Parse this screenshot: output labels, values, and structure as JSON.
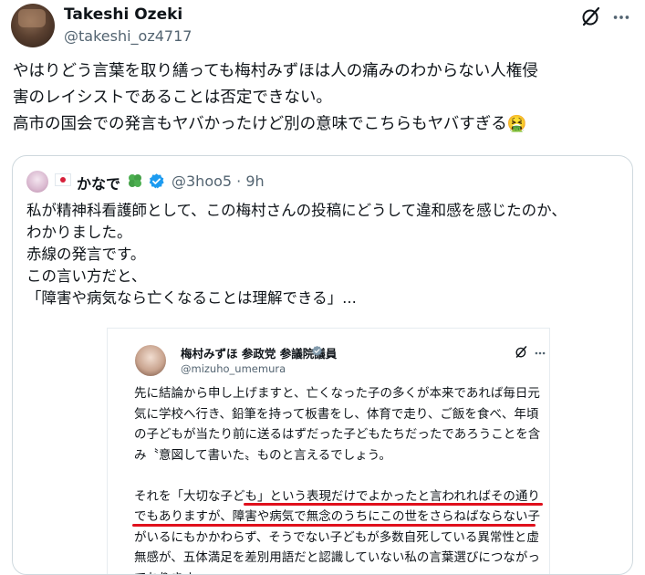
{
  "post": {
    "author_name": "Takeshi Ozeki",
    "author_handle": "@takeshi_oz4717",
    "text": "やはりどう言葉を取り繕っても梅村みずほは人の痛みのわからない人権侵\n害のレイシストであることは否定できない。\n高市の国会での発言もヤバかったけど別の意味でこちらもヤバすぎる🤮"
  },
  "quote": {
    "name": "かなで",
    "handle": "@3hoo5",
    "time": "9h",
    "meta": "@3hoo5 · 9h",
    "text": "私が精神科看護師として、この梅村さんの投稿にどうして違和感を感じたのか、\nわかりました。\n赤線の発言です。\nこの言い方だと、\n「障害や病気なら亡くなることは理解できる」..."
  },
  "screenshot": {
    "name": "梅村みずほ 参政党 参議院議員",
    "handle": "@mizuho_umemura",
    "text": "先に結論から申し上げますと、亡くなった子の多くが本来であれば毎日元\n気に学校へ行き、鉛筆を持って板書をし、体育で走り、ご飯を食べ、年頃\nの子どもが当たり前に送るはずだった子どもたちだったであろうことを含\nみ〝意図して書いた〟ものと言えるでしょう。\n\nそれを「大切な子ども」という表現だけでよかったと言われればその通り\nでもありますが、障害や病気で無念のうちにこの世をさらねばならない子\nがいるにもかかわらず、そうでない子どもが多数自死している異常性と虚\n無感が、五体満足を差別用語だと認識していない私の言葉選びにつながっ\nております。"
  },
  "colors": {
    "accent": "#1d9bf0",
    "underline": "#e0101c",
    "secondary_text": "#536471"
  },
  "icons": [
    "grok-icon",
    "more-icon",
    "japan-flag-icon",
    "clover-icon",
    "verified-badge-icon"
  ]
}
